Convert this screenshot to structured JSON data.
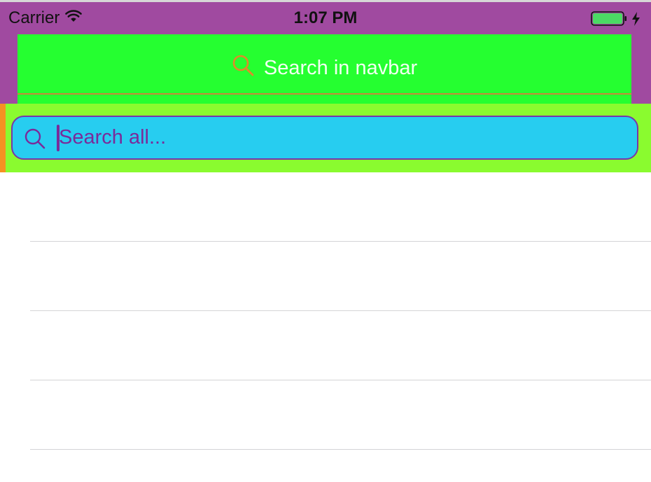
{
  "status_bar": {
    "carrier": "Carrier",
    "time": "1:07 PM",
    "icons": [
      "wifi-icon",
      "battery-icon",
      "charging-bolt-icon"
    ]
  },
  "navbar": {
    "search_label": "Search in navbar",
    "search_icon": "search-icon",
    "background_color": "#a04aa0",
    "search_bg_color": "#25ff30"
  },
  "search": {
    "placeholder": "Search all...",
    "value": "",
    "bar_color": "#8afb2f",
    "field_color": "#27cdf0"
  },
  "table": {
    "rows": [
      {
        "text": ""
      },
      {
        "text": ""
      },
      {
        "text": ""
      },
      {
        "text": ""
      }
    ]
  }
}
